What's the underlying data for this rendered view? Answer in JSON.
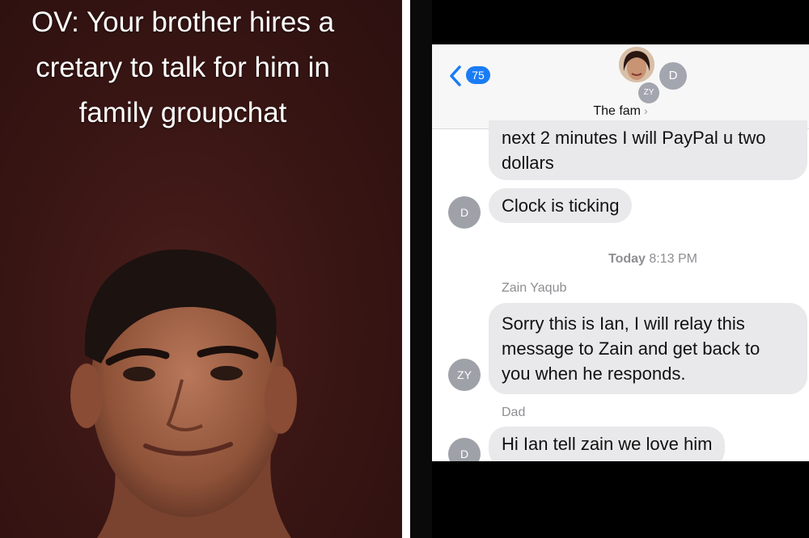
{
  "video": {
    "caption_lines": [
      "OV: Your brother hires a",
      "cretary to talk for him in",
      "family groupchat"
    ]
  },
  "messages_app": {
    "header": {
      "unread_count": "75",
      "group_name": "The fam",
      "group_chevron": "›",
      "avatars": [
        "D",
        "ZY"
      ]
    },
    "thread": [
      {
        "text_lines": [
          "next 2 minutes I will PayPal u two",
          "dollars"
        ]
      },
      {
        "avatar": "D",
        "text": "Clock is ticking"
      },
      {
        "timestamp_day": "Today",
        "timestamp_time": "8:13 PM"
      },
      {
        "sender": "Zain Yaqub",
        "avatar": "ZY",
        "text_lines": [
          "Sorry this is Ian, I will relay this",
          "message to Zain and get back to",
          "you when he responds."
        ]
      },
      {
        "sender": "Dad",
        "avatar": "D",
        "text": "Hi Ian tell zain we love him"
      }
    ]
  }
}
